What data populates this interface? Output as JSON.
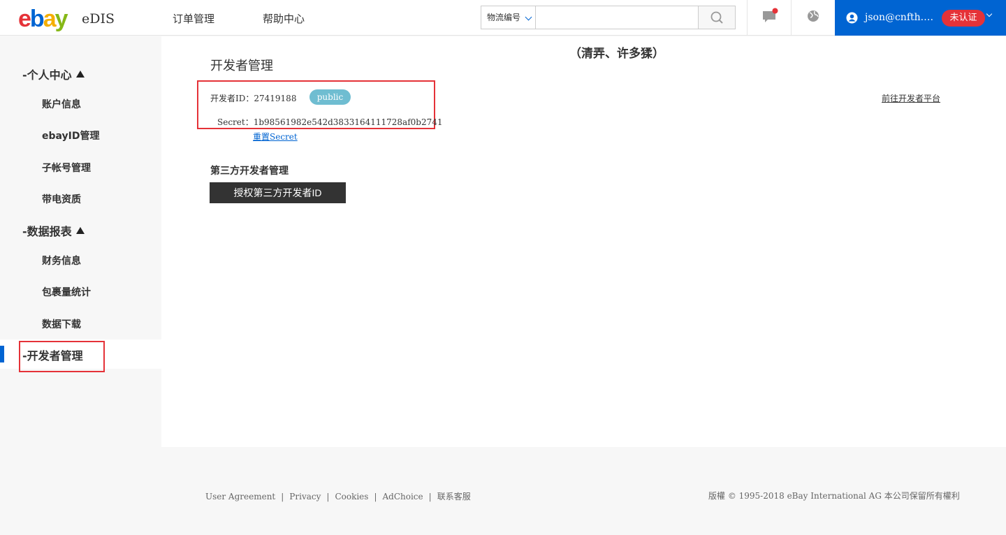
{
  "header": {
    "logo": {
      "e": "e",
      "b": "b",
      "a": "a",
      "y": "y"
    },
    "product": "eDIS",
    "nav": [
      {
        "label": "订单管理"
      },
      {
        "label": "帮助中心"
      }
    ],
    "search": {
      "select_value": "物流编号",
      "placeholder": ""
    },
    "icons": [
      "search-icon",
      "message-icon",
      "globe-icon",
      "user-icon"
    ],
    "user": {
      "name": "json@cnfth.…",
      "cert_status": "未认证"
    },
    "colors": {
      "brand_blue": "#0064d2",
      "alert_red": "#e53238"
    }
  },
  "sidebar": {
    "groups": [
      {
        "label": "个人中心",
        "prefix": "-"
      },
      {
        "label": "数据报表",
        "prefix": "-"
      },
      {
        "label": "开发者管理",
        "prefix": "-"
      }
    ],
    "items": [
      {
        "label": "账户信息"
      },
      {
        "label": "ebayID管理"
      },
      {
        "label": "子帐号管理"
      },
      {
        "label": "带电资质"
      },
      {
        "label": "财务信息"
      },
      {
        "label": "包裹量统计"
      },
      {
        "label": "数据下载"
      }
    ]
  },
  "main": {
    "title": "开发者管理",
    "annotation": "（清弄、许多猱）",
    "developer_id_label": "开发者ID：",
    "developer_id": "27419188",
    "scope_badge": "public",
    "secret_label": "Secret：",
    "secret": "1b98561982e542d3833164111728af0b2741",
    "reset_link": "重置Secret",
    "goto_link": "前往开发者平台",
    "third_party_title": "第三方开发者管理",
    "auth_button": "授权第三方开发者ID"
  },
  "footer": {
    "links": [
      {
        "label": "User Agreement"
      },
      {
        "label": "Privacy"
      },
      {
        "label": "Cookies"
      },
      {
        "label": "AdChoice"
      },
      {
        "label": "联系客服"
      }
    ],
    "separator": "|",
    "copyright": "版權 © 1995-2018 eBay International AG 本公司保留所有權利"
  }
}
